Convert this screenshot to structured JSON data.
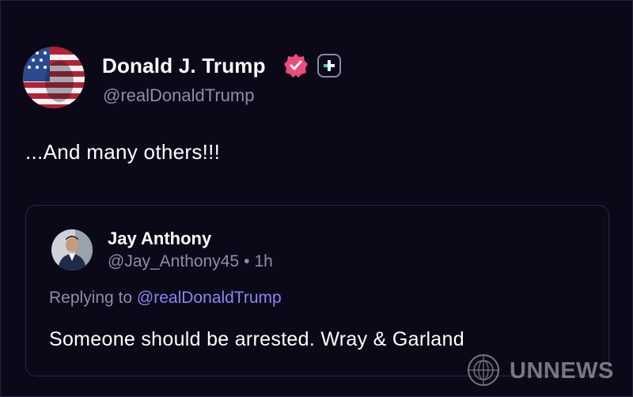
{
  "post": {
    "author_name": "Donald J. Trump",
    "author_handle": "@realDonaldTrump",
    "text": "...And many others!!!",
    "verified_icon": "verified-badge-icon",
    "follow_icon": "plus-icon"
  },
  "quoted": {
    "author_name": "Jay Anthony",
    "author_handle": "@Jay_Anthony45",
    "separator": "•",
    "time": "1h",
    "reply_prefix": "Replying to",
    "reply_mention": "@realDonaldTrump",
    "text": "Someone should be arrested. Wray & Garland"
  },
  "watermark": {
    "text": "UNNEWS"
  },
  "colors": {
    "background": "#0b0918",
    "secondary_text": "#8f8ca6",
    "mention": "#8a86f2",
    "verified": "#ec4c78"
  }
}
